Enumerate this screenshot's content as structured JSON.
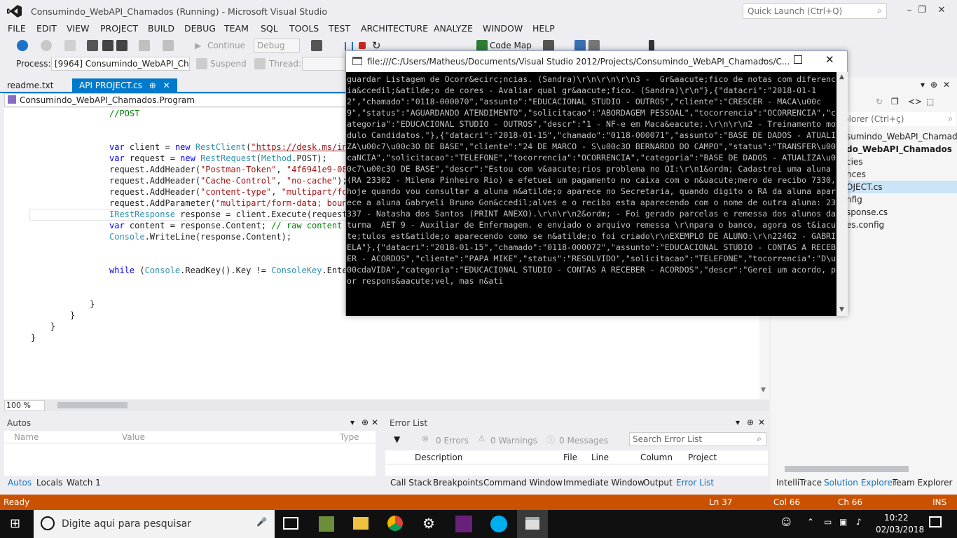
{
  "window": {
    "title": "Consumindo_WebAPI_Chamados (Running) - Microsoft Visual Studio",
    "quick_launch": "Quick Launch (Ctrl+Q)"
  },
  "menu": [
    "FILE",
    "EDIT",
    "VIEW",
    "PROJECT",
    "BUILD",
    "DEBUG",
    "TEAM",
    "SQL",
    "TOOLS",
    "TEST",
    "ARCHITECTURE",
    "ANALYZE",
    "WINDOW",
    "HELP"
  ],
  "toolbar": {
    "continue": "Continue",
    "config": "Debug",
    "codemap": "Code Map",
    "process_label": "Process:",
    "process_value": "[9964] Consumindo_WebAPI_Char",
    "suspend": "Suspend",
    "thread_label": "Thread:"
  },
  "tabs": {
    "readme": "readme.txt",
    "active": "API PROJECT.cs"
  },
  "navbar": {
    "class_path": "Consumindo_WebAPI_Chamados.Program"
  },
  "code": {
    "l1": "//POST",
    "l2a": "var",
    "l2b": " client = ",
    "l2c": "new",
    "l2d": "RestClient",
    "l2e": "(",
    "l2f": "\"https://desk.ms/int",
    "l3a": "var",
    "l3b": " request = ",
    "l3c": "new",
    "l3d": "RestRequest",
    "l3e": "(",
    "l3f": "Method",
    "l3g": ".POST);",
    "l4a": "request.AddHeader(",
    "l4b": "\"Postman-Token\"",
    "l4c": ", ",
    "l4d": "\"4f6941e9-08b",
    "l5a": "request.AddHeader(",
    "l5b": "\"Cache-Control\"",
    "l5c": ", ",
    "l5d": "\"no-cache\"",
    "l5e": ");",
    "l6a": "request.AddHeader(",
    "l6b": "\"content-type\"",
    "l6c": ", ",
    "l6d": "\"multipart/for",
    "l7a": "request.AddParameter(",
    "l7b": "\"multipart/form-data; bound",
    "l8a": "IRestResponse",
    "l8b": " response = client.Execute(request)",
    "l9a": "var",
    "l9b": " content = response.Content; ",
    "l9c": "// raw content a",
    "l10a": "Console",
    "l10b": ".WriteLine(response.Content);",
    "l11a": "while",
    "l11b": " (",
    "l11c": "Console",
    "l11d": ".ReadKey().Key != ",
    "l11e": "ConsoleKey",
    "l11f": ".Enter",
    "b1": "}",
    "b2": "}",
    "b3": "}",
    "b4": "}"
  },
  "zoom": "100 %",
  "autos": {
    "title": "Autos",
    "col_name": "Name",
    "col_value": "Value",
    "col_type": "Type",
    "tabs": [
      "Autos",
      "Locals",
      "Watch 1"
    ]
  },
  "errors": {
    "title": "Error List",
    "errors": "0 Errors",
    "warnings": "0 Warnings",
    "messages": "0 Messages",
    "search": "Search Error List",
    "cols": [
      "Description",
      "File",
      "Line",
      "Column",
      "Project"
    ],
    "tabs": [
      "Call Stack",
      "Breakpoints",
      "Command Window",
      "Immediate Window",
      "Output",
      "Error List"
    ]
  },
  "solution": {
    "search": "plorer (Ctrl+ç)",
    "items": [
      "sumindo_WebAPI_Chamado",
      "do_WebAPI_Chamados",
      "cies",
      "nces",
      "OJECT.cs",
      "nfig",
      "sponse.cs",
      "es.config"
    ],
    "tabs": [
      "IntelliTrace",
      "Solution Explorer",
      "Team Explorer"
    ]
  },
  "status": {
    "ready": "Ready",
    "ln": "Ln 37",
    "col": "Col 66",
    "ch": "Ch 66",
    "ins": "INS"
  },
  "taskbar": {
    "search": "Digite aqui para pesquisar",
    "time": "10:22",
    "date": "02/03/2018"
  },
  "console": {
    "title": "file:///C:/Users/Matheus/Documents/Visual Studio 2012/Projects/Consumindo_WebAPI_Chamados/C...",
    "text": "guardar Listagem de Ocorr&ecirc;ncias. (Sandra)\\r\\n\\r\\n\\r\\n3 -  Gr&aacute;fico de notas com diferencia&ccedil;&atilde;o de cores - Avaliar qual gr&aacute;fico. (Sandra)\\r\\n\"},{\"datacri\":\"2018-01-12\",\"chamado\":\"0118-000070\",\"assunto\":\"EDUCACIONAL STUDIO - OUTROS\",\"cliente\":\"CRESCER - MACA\\u00c9\",\"status\":\"AGUARDANDO ATENDIMENTO\",\"solicitacao\":\"ABORDAGEM PESSOAL\",\"tocorrencia\":\"OCORRENCIA\",\"categoria\":\"EDUCACIONAL STUDIO - OUTROS\",\"descr\":\"1 - NF-e em Maca&eacute;.\\r\\n\\r\\n2 - Treinamento modulo Candidatos.\"},{\"datacri\":\"2018-01-15\",\"chamado\":\"0118-000071\",\"assunto\":\"BASE DE DADOS - ATUALIZA\\u00c7\\u00c3O DE BASE\",\"cliente\":\"24 DE MARCO - S\\u00c3O BERNARDO DO CAMPO\",\"status\":\"TRANSFER\\u00caNCIA\",\"solicitacao\":\"TELEFONE\",\"tocorrencia\":\"OCORRENCIA\",\"categoria\":\"BASE DE DADOS - ATUALIZA\\u00c7\\u00c3O DE BASE\",\"descr\":\"Estou com v&aacute;rios problema no QI:\\r\\n1&ordm; Cadastrei uma aluna (RA 23302 - Milena Pinheiro Rio) e efetuei um pagamento no caixa com o n&uacute;mero de recibo 7330, hoje quando vou consultar a aluna n&atilde;o aparece no Secretaria, quando digito o RA da aluna aparece a aluna Gabryeli Bruno Gon&ccedil;alves e o recibo esta aparecendo com o nome de outra aluna: 23337 - Natasha dos Santos (PRINT ANEXO).\\r\\n\\r\\n2&ordm; - Foi gerado parcelas e remessa dos alunos da turma  AET 9 - Auxiliar de Enfermagem. e enviado o arquivo remessa \\r\\npara o banco, agora os t&iacute;tulos est&atilde;o aparecendo como se n&atilde;o foi criado\\r\\nEXEMPLO DE ALUNO:\\r\\n22462 - GABRIELA\"},{\"datacri\":\"2018-01-15\",\"chamado\":\"0118-000072\",\"assunto\":\"EDUCACIONAL STUDIO - CONTAS A RECEBER - ACORDOS\",\"cliente\":\"PAPA MIKE\",\"status\":\"RESOLVIDO\",\"solicitacao\":\"TELEFONE\",\"tocorrencia\":\"D\\u00cdaVIDA\",\"categoria\":\"EDUCACIONAL STUDIO - CONTAS A RECEBER - ACORDOS\",\"descr\":\"Gerei um acordo, por respons&aacute;vel, mas n&ati"
  }
}
